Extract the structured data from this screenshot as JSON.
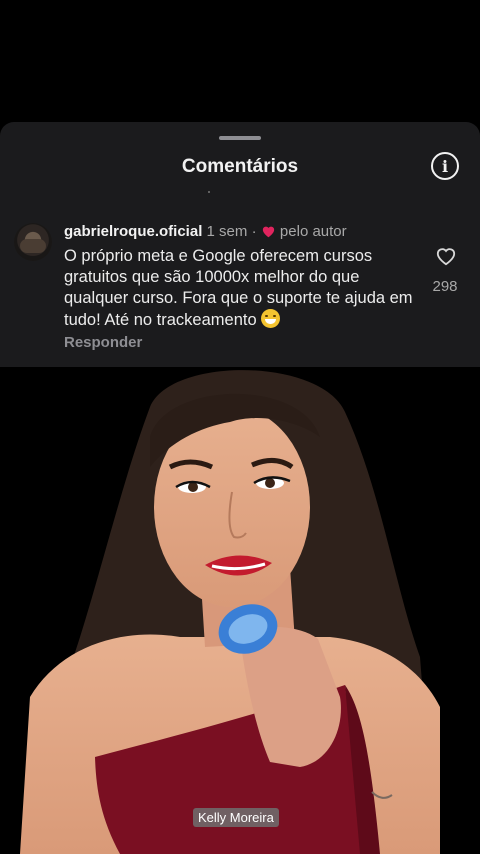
{
  "sheet": {
    "title": "Comentários"
  },
  "comment": {
    "username": "gabrielroque.oficial",
    "time": "1 sem",
    "separator": "·",
    "author_badge": "pelo autor",
    "text": "O próprio meta e Google oferecem cursos gratuitos que são 10000x melhor do que qualquer curso. Fora que o suporte te ajuda em tudo! Até no trackeamento",
    "likes": "298",
    "reply_label": "Responder"
  },
  "video": {
    "caption": "Kelly Moreira"
  },
  "icons": {
    "info": "info-icon",
    "like": "heart-outline-icon",
    "author_heart": "red-heart-icon",
    "emoji": "grinning-sweat-emoji"
  },
  "colors": {
    "sheet_bg": "#1b1b1d",
    "author_heart": "#e0245e",
    "muted": "#a8a8a8"
  }
}
